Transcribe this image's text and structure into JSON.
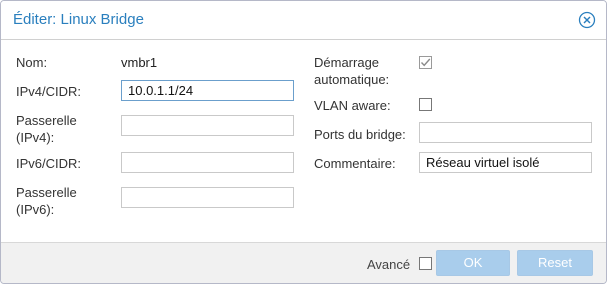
{
  "dialog": {
    "title": "Éditer: Linux Bridge",
    "close_icon": "close-circle-icon"
  },
  "left": {
    "name_label": "Nom:",
    "name_value": "vmbr1",
    "ipv4_label": "IPv4/CIDR:",
    "ipv4_value": "10.0.1.1/24",
    "gw4_label_1": "Passerelle",
    "gw4_label_2": "(IPv4):",
    "gw4_value": "",
    "ipv6_label": "IPv6/CIDR:",
    "ipv6_value": "",
    "gw6_label_1": "Passerelle",
    "gw6_label_2": "(IPv6):",
    "gw6_value": ""
  },
  "right": {
    "autostart_label_1": "Démarrage",
    "autostart_label_2": "automatique:",
    "autostart_checked": true,
    "vlan_label": "VLAN aware:",
    "vlan_checked": false,
    "ports_label": "Ports du bridge:",
    "ports_value": "",
    "comment_label": "Commentaire:",
    "comment_value": "Réseau virtuel isolé"
  },
  "footer": {
    "advanced_label": "Avancé",
    "advanced_checked": false,
    "ok_label": "OK",
    "reset_label": "Reset"
  },
  "colors": {
    "title": "#2a7fbe",
    "button_disabled": "#a9cdec"
  }
}
